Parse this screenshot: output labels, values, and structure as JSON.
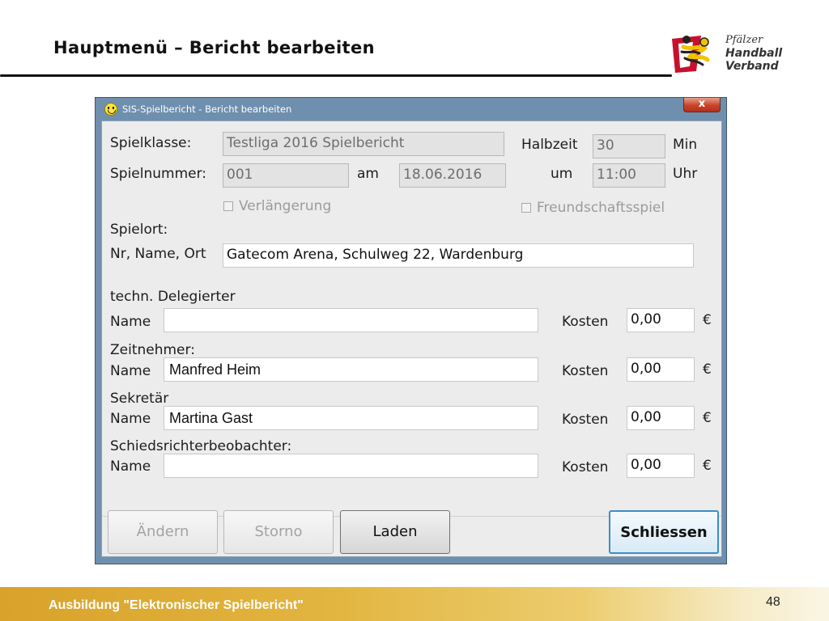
{
  "slide": {
    "title": "Hauptmenü – Bericht bearbeiten",
    "logo": {
      "line1": "Pfälzer",
      "line2": "Handball",
      "line3": "Verband"
    },
    "footer_text": "Ausbildung \"Elektronischer Spielbericht\"",
    "page_number": "48"
  },
  "window": {
    "title": "SIS-Spielbericht - Bericht bearbeiten",
    "close_label": "x"
  },
  "form": {
    "spielklasse_label": "Spielklasse:",
    "spielklasse_value": "Testliga 2016 Spielbericht",
    "halbzeit_label": "Halbzeit",
    "halbzeit_value": "30",
    "min_label": "Min",
    "spielnummer_label": "Spielnummer:",
    "spielnummer_value": "001",
    "am_label": "am",
    "date_value": "18.06.2016",
    "um_label": "um",
    "time_value": "11:00",
    "uhr_label": "Uhr",
    "verlaengerung_label": "Verlängerung",
    "freundschaftsspiel_label": "Freundschaftsspiel",
    "spielort_label": "Spielort:",
    "ort_label": "Nr, Name, Ort",
    "ort_value": "Gatecom Arena, Schulweg 22, Wardenburg"
  },
  "officials": [
    {
      "heading": "techn. Delegierter",
      "name_label": "Name",
      "name_value": "",
      "kosten_label": "Kosten",
      "kosten_value": "0,00",
      "currency": "€"
    },
    {
      "heading": "Zeitnehmer:",
      "name_label": "Name",
      "name_value": "Manfred Heim",
      "kosten_label": "Kosten",
      "kosten_value": "0,00",
      "currency": "€"
    },
    {
      "heading": "Sekretär",
      "name_label": "Name",
      "name_value": "Martina Gast",
      "kosten_label": "Kosten",
      "kosten_value": "0,00",
      "currency": "€"
    },
    {
      "heading": "Schiedsrichterbeobachter:",
      "name_label": "Name",
      "name_value": "",
      "kosten_label": "Kosten",
      "kosten_value": "0,00",
      "currency": "€"
    }
  ],
  "buttons": {
    "aendern": "Ändern",
    "storno": "Storno",
    "laden": "Laden",
    "schliessen": "Schliessen"
  },
  "colors": {
    "titlebar": "#6f8fae",
    "footer_gold": "#d9a22a",
    "default_button_border": "#3c8ec5"
  }
}
